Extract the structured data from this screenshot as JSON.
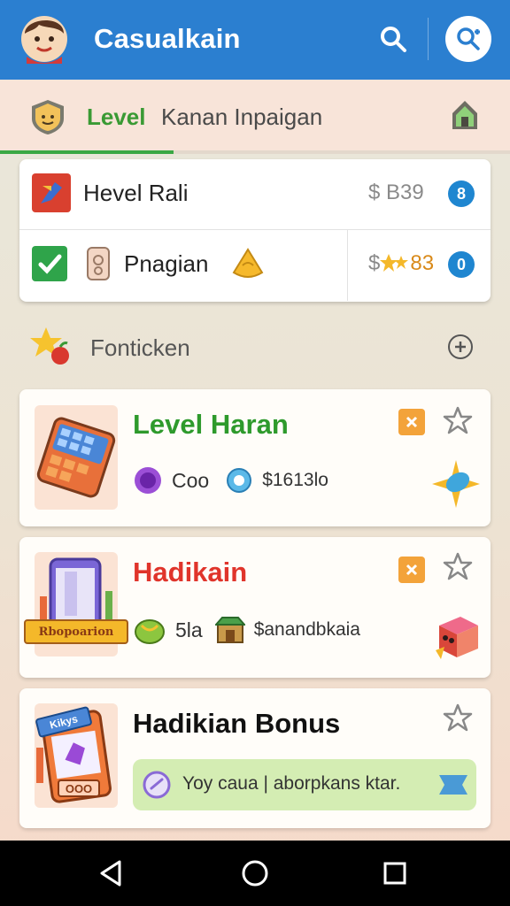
{
  "app": {
    "title": "Casualkain",
    "accent": "#2b7fd0"
  },
  "icons": {
    "avatar": "avatar",
    "search": "search-icon",
    "action": "search-plus-icon",
    "home": "home-icon",
    "level": "shield-icon"
  },
  "level": {
    "label": "Level",
    "subtitle": "Kanan Inpaigan",
    "progress": 0.34
  },
  "summary": {
    "rows": [
      {
        "label": "Hevel Rali",
        "amount": "$ B39",
        "count": "8"
      },
      {
        "label": "Pnagian",
        "amount": "$ ",
        "amount_tail": "83",
        "count": "0"
      }
    ]
  },
  "section": {
    "title": "Fonticken"
  },
  "quests": [
    {
      "title": "Level Haran",
      "title_color": "#2e9a2c",
      "meta_label": "Coo",
      "price": "$1613lo"
    },
    {
      "title": "Hadikain",
      "title_color": "#e0342b",
      "meta_label": "5la",
      "price": "$anandbkaia",
      "thumb_ribbon": "Rbopoarion"
    },
    {
      "title": "Hadikian Bonus",
      "title_color": "#111111",
      "banner_text": "Yoy caua | aborpkans ktar.",
      "thumb_tag": "Kikys",
      "thumb_counter": "OOO"
    }
  ],
  "nav": {
    "back": "back-icon",
    "home": "home-circle-icon",
    "recents": "recents-icon"
  }
}
